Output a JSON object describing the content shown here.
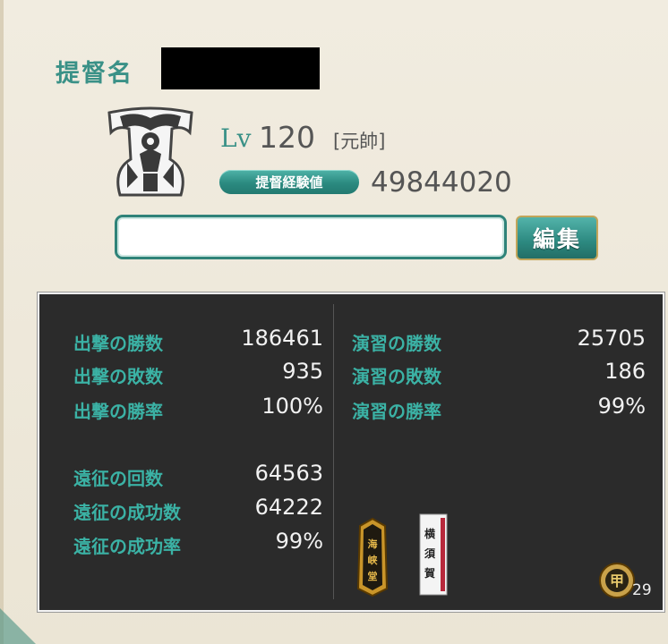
{
  "profile": {
    "name_label": "提督名",
    "emblem_text": "元帥",
    "lv_label": "Lv",
    "level": "120",
    "rank": "[元帥]",
    "exp_label": "提督経験値",
    "exp_value": "49844020",
    "comment_value": "",
    "edit_label": "編集"
  },
  "stats": {
    "left": [
      {
        "label": "出撃の勝数",
        "value": "186461"
      },
      {
        "label": "出撃の敗数",
        "value": "935"
      },
      {
        "label": "出撃の勝率",
        "value": "100%"
      },
      {
        "label": "遠征の回数",
        "value": "64563"
      },
      {
        "label": "遠征の成功数",
        "value": "64222"
      },
      {
        "label": "遠征の成功率",
        "value": "99%"
      }
    ],
    "right": [
      {
        "label": "演習の勝数",
        "value": "25705"
      },
      {
        "label": "演習の敗数",
        "value": "186"
      },
      {
        "label": "演習の勝率",
        "value": "99%"
      }
    ]
  },
  "medals": {
    "gold_text": "海峡堂",
    "white_text": "横須賀",
    "rank_badge_text": "甲",
    "rank_badge_count": "29"
  },
  "colors": {
    "accent": "#3a9187",
    "panel_bg": "#2b2b2b",
    "stat_label": "#3bb2a5",
    "emblem_gold": "#e6a216"
  }
}
